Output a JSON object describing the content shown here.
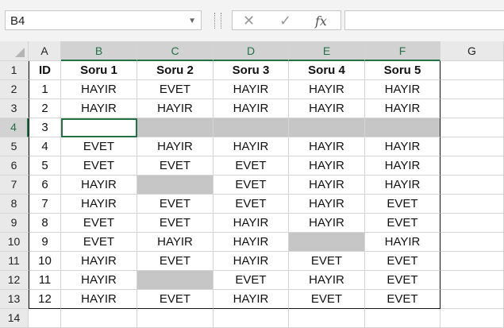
{
  "name_box": {
    "value": "B4"
  },
  "formula_bar": {
    "cancel_glyph": "✕",
    "enter_glyph": "✓",
    "fx_label": "fx",
    "value": ""
  },
  "columns": [
    "A",
    "B",
    "C",
    "D",
    "E",
    "F",
    "G"
  ],
  "row_numbers": [
    "1",
    "2",
    "3",
    "4",
    "5",
    "6",
    "7",
    "8",
    "9",
    "10",
    "11",
    "12",
    "13",
    "14"
  ],
  "selected_row": "4",
  "selected_columns": [
    "B",
    "C",
    "D",
    "E",
    "F"
  ],
  "table": {
    "headers": [
      "ID",
      "Soru 1",
      "Soru 2",
      "Soru 3",
      "Soru 4",
      "Soru 5"
    ],
    "rows": [
      [
        "1",
        "HAYIR",
        "EVET",
        "HAYIR",
        "HAYIR",
        "HAYIR"
      ],
      [
        "2",
        "HAYIR",
        "HAYIR",
        "HAYIR",
        "HAYIR",
        "HAYIR"
      ],
      [
        "3",
        "",
        "",
        "",
        "",
        ""
      ],
      [
        "4",
        "EVET",
        "HAYIR",
        "HAYIR",
        "HAYIR",
        "HAYIR"
      ],
      [
        "5",
        "EVET",
        "EVET",
        "EVET",
        "HAYIR",
        "HAYIR"
      ],
      [
        "6",
        "HAYIR",
        "",
        "EVET",
        "HAYIR",
        "HAYIR"
      ],
      [
        "7",
        "HAYIR",
        "EVET",
        "EVET",
        "HAYIR",
        "EVET"
      ],
      [
        "8",
        "EVET",
        "EVET",
        "HAYIR",
        "HAYIR",
        "EVET"
      ],
      [
        "9",
        "EVET",
        "HAYIR",
        "HAYIR",
        "",
        "HAYIR"
      ],
      [
        "10",
        "HAYIR",
        "EVET",
        "HAYIR",
        "EVET",
        "EVET"
      ],
      [
        "11",
        "HAYIR",
        "",
        "EVET",
        "HAYIR",
        "EVET"
      ],
      [
        "12",
        "HAYIR",
        "EVET",
        "HAYIR",
        "EVET",
        "EVET"
      ]
    ]
  },
  "blank_cells": [
    "C4",
    "D4",
    "E4",
    "F4",
    "C7",
    "E10",
    "C12"
  ],
  "active_cell": "B4",
  "colors": {
    "accent": "#217346",
    "blank_fill": "#c6c6c6",
    "header_bg": "#e9e9e9"
  }
}
